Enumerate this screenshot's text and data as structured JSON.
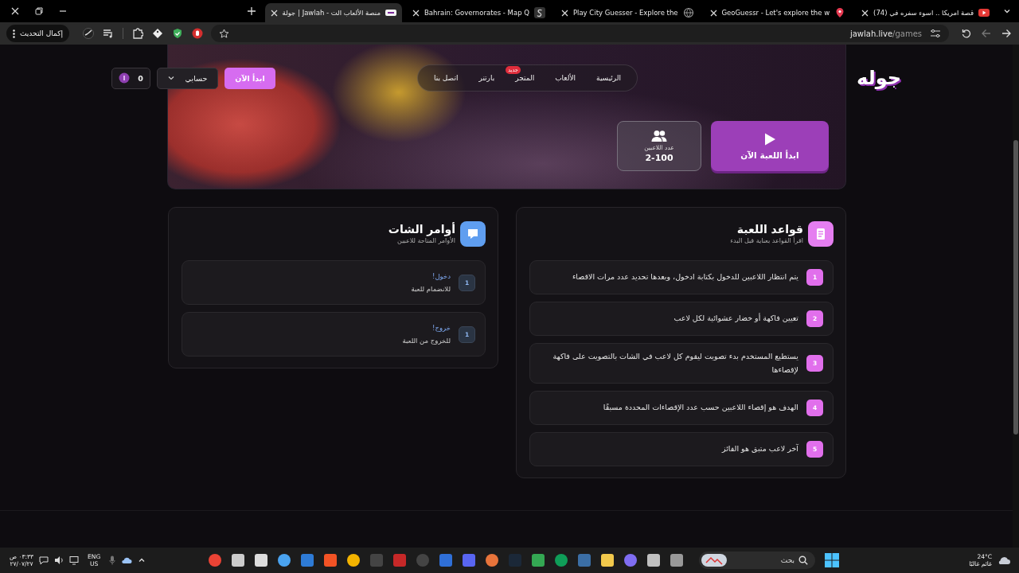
{
  "browser": {
    "tabs": [
      {
        "title": "(74) قصة امريكا .. اسوء سفره في",
        "kind": "video",
        "selected": false
      },
      {
        "title": "GeoGuessr - Let's explore the w",
        "kind": "pin",
        "selected": false
      },
      {
        "title": "Play City Guesser - Explore the",
        "kind": "globe",
        "selected": false
      },
      {
        "title": "Bahrain: Governorates - Map Q",
        "kind": "swirl",
        "selected": false
      },
      {
        "title": "جولة | Jawlah - منصة الألعاب الت",
        "kind": "site",
        "selected": true
      }
    ],
    "url_host": "jawlah.live",
    "url_path": "/games",
    "update_button": "إكمال التحديث"
  },
  "site": {
    "logo": "جوله",
    "nav": [
      {
        "label": "الرئيسية"
      },
      {
        "label": "الألعاب"
      },
      {
        "label": "المتجر",
        "badge": "جديد"
      },
      {
        "label": "بارتنر"
      },
      {
        "label": "اتصل بنا"
      }
    ],
    "start_button": "ابدأ الآن",
    "account_button": "حسابي",
    "coins": "0"
  },
  "hero": {
    "play_button": "ابدأ اللعبة الآن",
    "players_label": "عدد اللاعبين",
    "players_value": "2-100"
  },
  "rules": {
    "title": "قواعد اللعبة",
    "subtitle": "اقرأ القواعد بعناية قبل البدء",
    "items": [
      {
        "number": "1",
        "text": "يتم انتظار اللاعبين للدخول بكتابة ادخول، وبعدها تحديد عدد مرات الاقصاء"
      },
      {
        "number": "2",
        "text": "تعيين فاكهة أو خضار عشوائية لكل لاعب"
      },
      {
        "number": "3",
        "text": "يستطيع المستخدم بدء تصويت ليقوم كل لاعب في الشات بالتصويت على فاكهة لإقصاءها"
      },
      {
        "number": "4",
        "text": "الهدف هو إقصاء اللاعبين حسب عدد الإقصاءات المحددة مسبقًا"
      },
      {
        "number": "5",
        "text": "آخر لاعب متبق هو الفائز"
      }
    ]
  },
  "chat": {
    "title": "أوامر الشات",
    "subtitle": "الأوامر المتاحة للاعبين",
    "commands": [
      {
        "number": "1",
        "command": "!دخول",
        "description": "للانضمام للعبة"
      },
      {
        "number": "1",
        "command": "!خروج",
        "description": "للخروج من اللعبة"
      }
    ]
  },
  "taskbar": {
    "time": "٠٣:٣٣ ص",
    "date": "٢٧/٠٧/٢٧",
    "lang": "ENG",
    "region": "US",
    "search_placeholder": "بحث",
    "temperature": "24°C",
    "weather": "غائم غالبًا"
  }
}
